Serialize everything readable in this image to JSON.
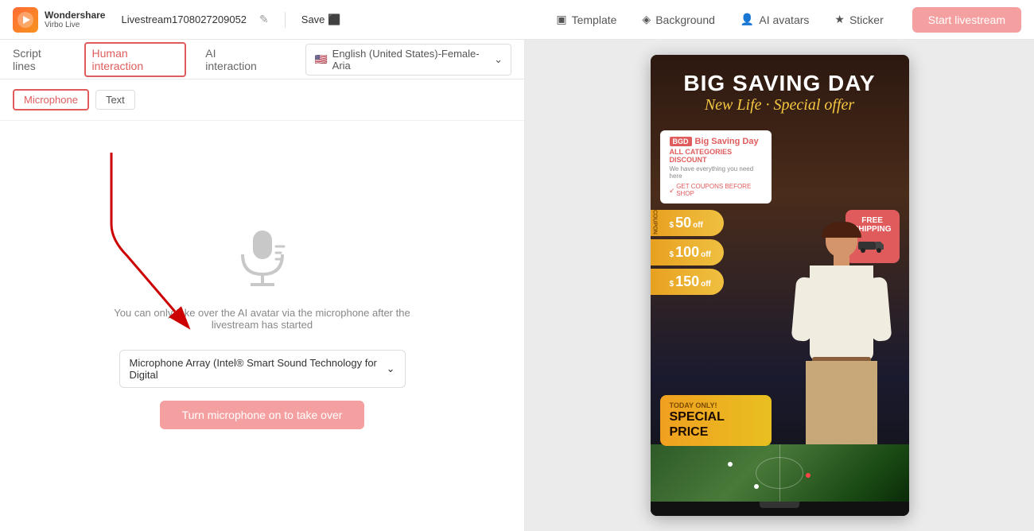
{
  "app": {
    "logo_line1": "Wondershare",
    "logo_line2": "Virbo Live",
    "project_name": "Livestream1708027209052",
    "edit_icon": "✎",
    "save_label": "Save",
    "save_icon": "💾"
  },
  "nav": {
    "template_label": "Template",
    "background_label": "Background",
    "ai_avatars_label": "AI avatars",
    "sticker_label": "Sticker",
    "start_label": "Start livestream"
  },
  "tabs": {
    "script_lines": "Script lines",
    "human_interaction": "Human interaction",
    "ai_interaction": "AI interaction"
  },
  "sub_tabs": {
    "microphone": "Microphone",
    "text": "Text"
  },
  "language": {
    "label": "English (United States)-Female-Aria",
    "flag": "🇺🇸"
  },
  "content": {
    "hint_text": "You can only take over the AI avatar via the microphone after the livestream has started",
    "dropdown_label": "Microphone Array (Intel® Smart Sound Technology for Digital",
    "dropdown_icon": "⌄",
    "turn_on_label": "Turn microphone on to take over"
  },
  "poster": {
    "title_main": "BIG SAVING DAY",
    "title_sub": "New Life · Special offer",
    "coupon_badge": "BGD",
    "coupon_title": "Big Saving Day",
    "coupon_sub": "ALL CATEGORIES DISCOUNT",
    "coupon_desc": "We have everything you need here",
    "coupon_link": "GET COUPONS BEFORE SHOP",
    "coupons": [
      {
        "dollar": "$",
        "amount": "50",
        "off": "off"
      },
      {
        "dollar": "$",
        "amount": "100",
        "off": "off"
      },
      {
        "dollar": "$",
        "amount": "150",
        "off": "off"
      }
    ],
    "free_shipping": "FREE\nSHIPPING",
    "today_label": "TODAY ONLY!",
    "today_price": "SPECIAL PRICE"
  }
}
